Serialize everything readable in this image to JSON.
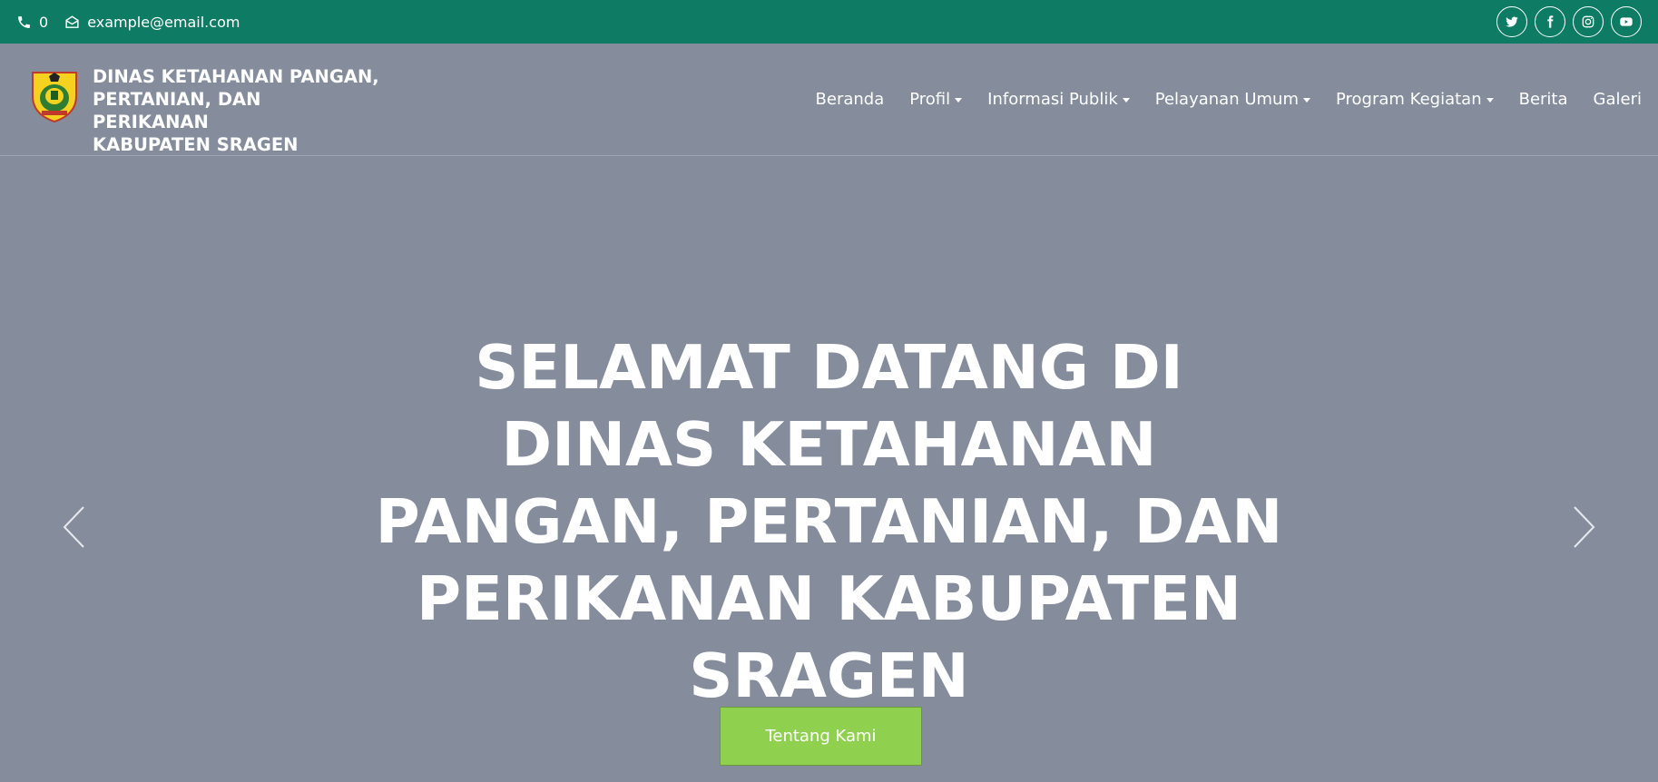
{
  "topbar": {
    "phone": "0",
    "email": "example@email.com",
    "socials": [
      "twitter-icon",
      "facebook-icon",
      "instagram-icon",
      "youtube-icon"
    ]
  },
  "brand": {
    "name_lines": [
      "DINAS KETAHANAN PANGAN,",
      "PERTANIAN, DAN PERIKANAN",
      "KABUPATEN SRAGEN"
    ]
  },
  "nav": {
    "items": [
      {
        "label": "Beranda",
        "dropdown": false
      },
      {
        "label": "Profil",
        "dropdown": true
      },
      {
        "label": "Informasi Publik",
        "dropdown": true
      },
      {
        "label": "Pelayanan Umum",
        "dropdown": true
      },
      {
        "label": "Program Kegiatan",
        "dropdown": true
      },
      {
        "label": "Berita",
        "dropdown": false
      },
      {
        "label": "Galeri",
        "dropdown": false
      }
    ]
  },
  "hero": {
    "title_lines": [
      "SELAMAT DATANG DI",
      "DINAS KETAHANAN",
      "PANGAN, PERTANIAN, DAN",
      "PERIKANAN KABUPATEN",
      "SRAGEN"
    ],
    "cta_label": "Tentang Kami"
  },
  "colors": {
    "topbar": "#0e7c64",
    "background": "#858d9d",
    "cta": "#8fd14f"
  }
}
